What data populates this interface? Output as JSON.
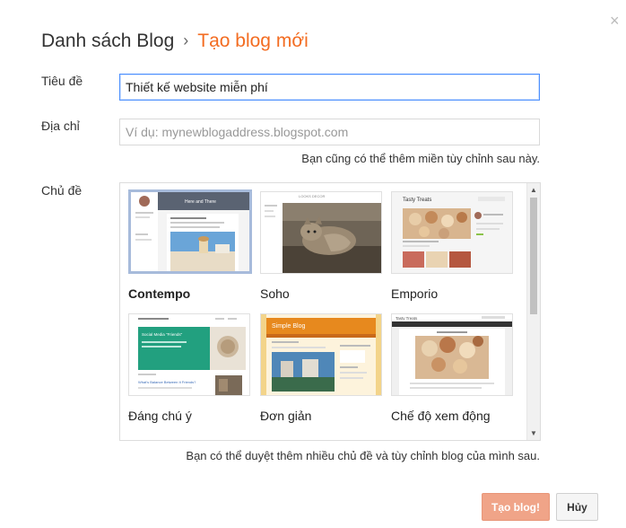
{
  "header": {
    "crumb": "Danh sách Blog",
    "separator": "›",
    "current": "Tạo blog mới"
  },
  "close_glyph": "×",
  "form": {
    "title_label": "Tiêu đề",
    "title_value": "Thiết kế website miễn phí",
    "address_label": "Địa chỉ",
    "address_placeholder": "Ví dụ: mynewblogaddress.blogspot.com",
    "address_hint": "Bạn cũng có thể thêm miền tùy chỉnh sau này.",
    "theme_label": "Chủ đề"
  },
  "themes": [
    {
      "name": "Contempo",
      "selected": true
    },
    {
      "name": "Soho",
      "selected": false
    },
    {
      "name": "Emporio",
      "selected": false
    },
    {
      "name": "Đáng chú ý",
      "selected": false
    },
    {
      "name": "Đơn giản",
      "selected": false
    },
    {
      "name": "Chế độ xem động",
      "selected": false
    }
  ],
  "thumb_text": {
    "contempo_header": "Here and There",
    "soho_header": "LOOKS DECOR",
    "emporio_title": "Tasty Treats",
    "notable_header": "Social Media \"Friends\"",
    "notable_sub": "What's Balance Between It Friends?",
    "simple_title": "Simple Blog",
    "dynamic_title": "Tasty Treats"
  },
  "themes_hint": "Bạn có thể duyệt thêm nhiều chủ đề và tùy chỉnh blog của mình sau.",
  "buttons": {
    "create": "Tạo blog!",
    "cancel": "Hủy"
  },
  "colors": {
    "accent": "#f36c21",
    "primary_button": "#f0a488",
    "notable_green": "#22a07f",
    "simple_orange": "#e7891e",
    "focus_blue": "#4d90fe"
  }
}
